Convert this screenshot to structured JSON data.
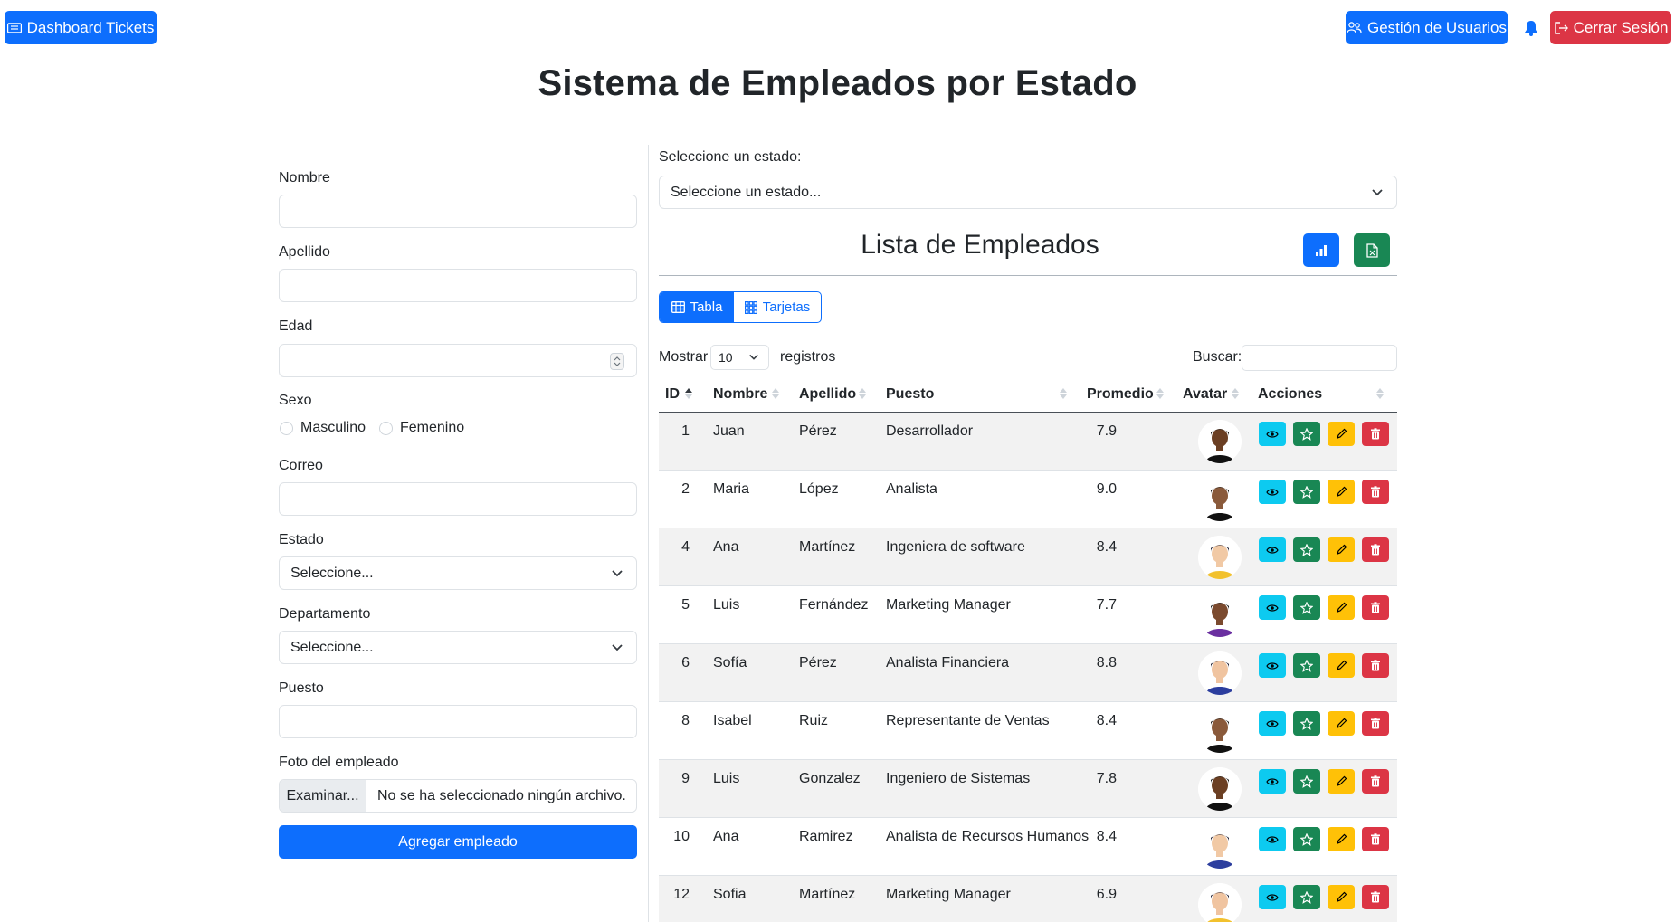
{
  "nav": {
    "dashboard": "Dashboard Tickets",
    "users": "Gestión de Usuarios",
    "logout": "Cerrar Sesión"
  },
  "title": "Sistema de Empleados por Estado",
  "form": {
    "nombre_label": "Nombre",
    "apellido_label": "Apellido",
    "edad_label": "Edad",
    "sexo_label": "Sexo",
    "sexo_options": [
      "Masculino",
      "Femenino"
    ],
    "correo_label": "Correo",
    "estado_label": "Estado",
    "estado_value": "Seleccione...",
    "departamento_label": "Departamento",
    "departamento_value": "Seleccione...",
    "puesto_label": "Puesto",
    "foto_label": "Foto del empleado",
    "file_button": "Examinar...",
    "file_status": "No se ha seleccionado ningún archivo.",
    "submit": "Agregar empleado"
  },
  "state_filter": {
    "label": "Seleccione un estado:",
    "value": "Seleccione un estado..."
  },
  "list": {
    "title": "Lista de Empleados",
    "view_table": "Tabla",
    "view_cards": "Tarjetas",
    "show_label": "Mostrar",
    "show_value": "10",
    "records_label": "registros",
    "search_label": "Buscar:"
  },
  "table": {
    "headers": [
      "ID",
      "Nombre",
      "Apellido",
      "Puesto",
      "Promedio",
      "Avatar",
      "Acciones"
    ],
    "rows": [
      {
        "id": "1",
        "nombre": "Juan",
        "apellido": "Pérez",
        "puesto": "Desarrollador",
        "promedio": "7.9"
      },
      {
        "id": "2",
        "nombre": "Maria",
        "apellido": "López",
        "puesto": "Analista",
        "promedio": "9.0"
      },
      {
        "id": "4",
        "nombre": "Ana",
        "apellido": "Martínez",
        "puesto": "Ingeniera de software",
        "promedio": "8.4"
      },
      {
        "id": "5",
        "nombre": "Luis",
        "apellido": "Fernández",
        "puesto": "Marketing Manager",
        "promedio": "7.7"
      },
      {
        "id": "6",
        "nombre": "Sofía",
        "apellido": "Pérez",
        "puesto": "Analista Financiera",
        "promedio": "8.8"
      },
      {
        "id": "8",
        "nombre": "Isabel",
        "apellido": "Ruiz",
        "puesto": "Representante de Ventas",
        "promedio": "8.4"
      },
      {
        "id": "9",
        "nombre": "Luis",
        "apellido": "Gonzalez",
        "puesto": "Ingeniero de Sistemas",
        "promedio": "7.8"
      },
      {
        "id": "10",
        "nombre": "Ana",
        "apellido": "Ramirez",
        "puesto": "Analista de Recursos Humanos",
        "promedio": "8.4"
      },
      {
        "id": "12",
        "nombre": "Sofia",
        "apellido": "Martínez",
        "puesto": "Marketing Manager",
        "promedio": "6.9"
      }
    ]
  },
  "colors": {
    "primary": "#0d6efd",
    "danger": "#dc3545",
    "success": "#198754",
    "info": "#0dcaf0",
    "warning": "#ffc107"
  }
}
